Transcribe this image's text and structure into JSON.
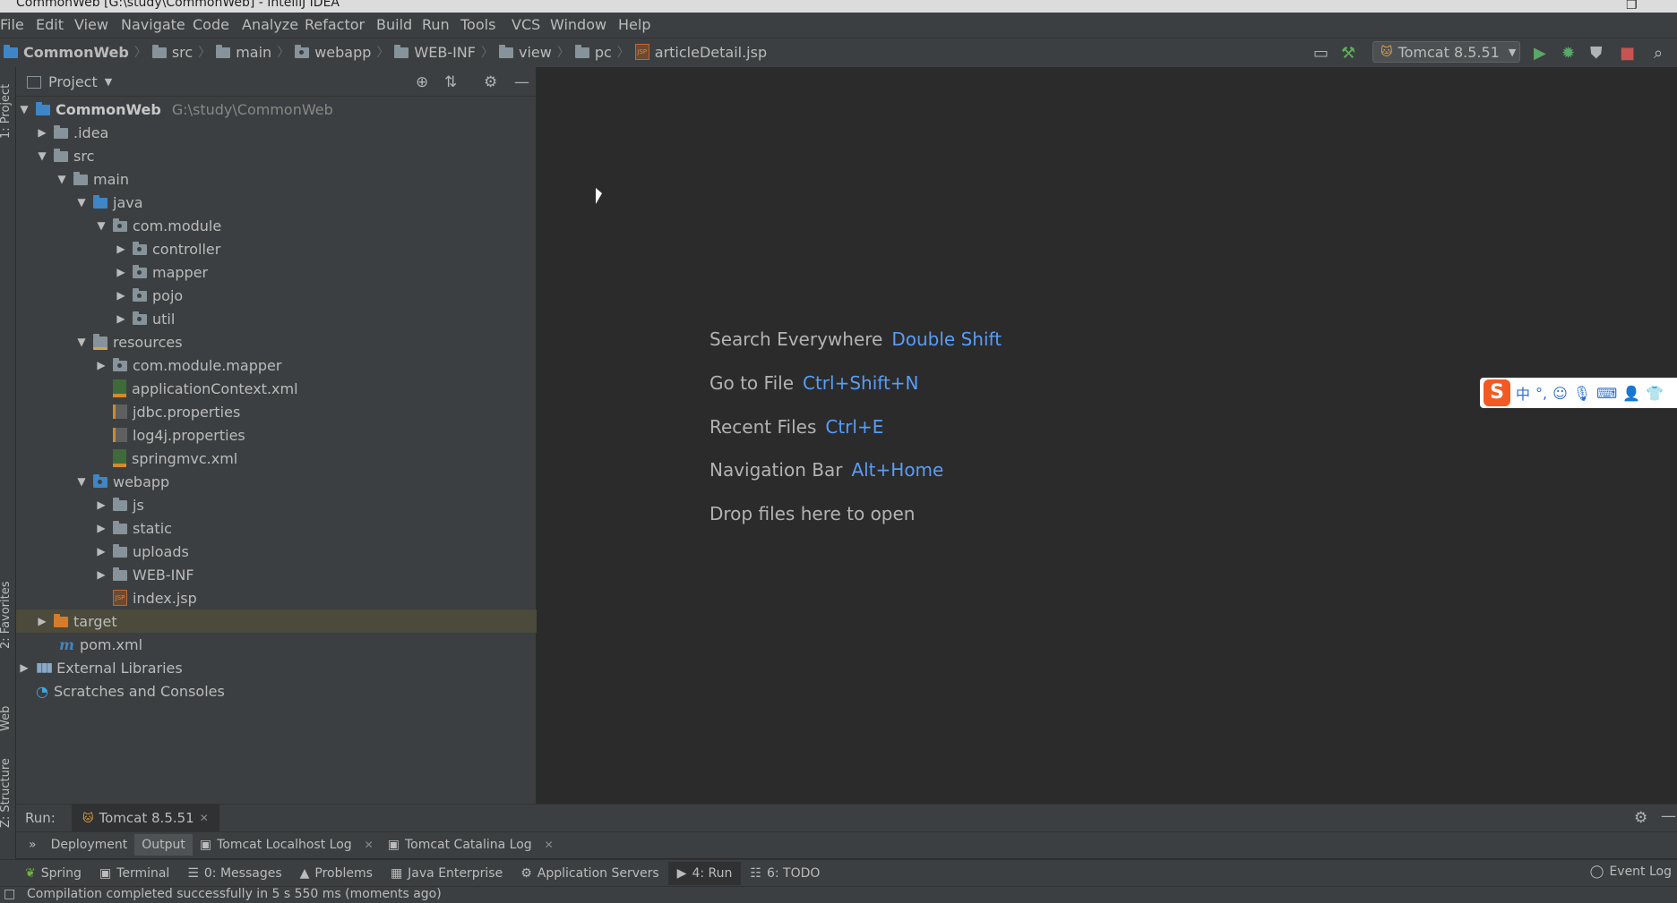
{
  "window": {
    "title": "CommonWeb [G:\\study\\CommonWeb] - IntelliJ IDEA"
  },
  "menu": [
    "File",
    "Edit",
    "View",
    "Navigate",
    "Code",
    "Analyze",
    "Refactor",
    "Build",
    "Run",
    "Tools",
    "VCS",
    "Window",
    "Help"
  ],
  "breadcrumb": [
    "CommonWeb",
    "src",
    "main",
    "webapp",
    "WEB-INF",
    "view",
    "pc",
    "articleDetail.jsp"
  ],
  "run_config": "Tomcat 8.5.51",
  "left_tabs": [
    "1: Project",
    "2: Favorites",
    "Web",
    "Z: Structure"
  ],
  "project_panel": {
    "title": "Project",
    "tree": [
      {
        "label": "CommonWeb",
        "path": "G:\\study\\CommonWeb"
      },
      {
        "label": ".idea"
      },
      {
        "label": "src"
      },
      {
        "label": "main"
      },
      {
        "label": "java"
      },
      {
        "label": "com.module"
      },
      {
        "label": "controller"
      },
      {
        "label": "mapper"
      },
      {
        "label": "pojo"
      },
      {
        "label": "util"
      },
      {
        "label": "resources"
      },
      {
        "label": "com.module.mapper"
      },
      {
        "label": "applicationContext.xml"
      },
      {
        "label": "jdbc.properties"
      },
      {
        "label": "log4j.properties"
      },
      {
        "label": "springmvc.xml"
      },
      {
        "label": "webapp"
      },
      {
        "label": "js"
      },
      {
        "label": "static"
      },
      {
        "label": "uploads"
      },
      {
        "label": "WEB-INF"
      },
      {
        "label": "index.jsp"
      },
      {
        "label": "target"
      },
      {
        "label": "pom.xml"
      },
      {
        "label": "External Libraries"
      },
      {
        "label": "Scratches and Consoles"
      }
    ]
  },
  "editor_hints": [
    {
      "text": "Search Everywhere",
      "key": "Double Shift"
    },
    {
      "text": "Go to File",
      "key": "Ctrl+Shift+N"
    },
    {
      "text": "Recent Files",
      "key": "Ctrl+E"
    },
    {
      "text": "Navigation Bar",
      "key": "Alt+Home"
    },
    {
      "text": "Drop files here to open",
      "key": ""
    }
  ],
  "ime": {
    "mode": "中"
  },
  "run_panel": {
    "label": "Run:",
    "tab": "Tomcat 8.5.51",
    "subtabs": [
      "Deployment",
      "Output",
      "Tomcat Localhost Log",
      "Tomcat Catalina Log"
    ]
  },
  "tool_windows": [
    "Spring",
    "Terminal",
    "0: Messages",
    "Problems",
    "Java Enterprise",
    "Application Servers",
    "4: Run",
    "6: TODO"
  ],
  "event_log": "Event Log",
  "status": "Compilation completed successfully in 5 s 550 ms (moments ago)",
  "colors": {
    "accent_link": "#589df6",
    "selection": "#4b4a3b",
    "panel": "#3c3f41",
    "editor": "#2b2b2b"
  }
}
